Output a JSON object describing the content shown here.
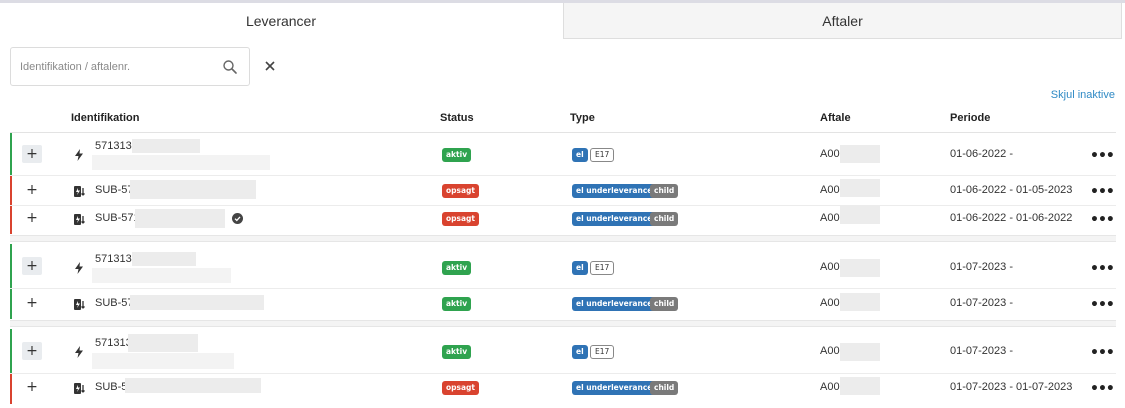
{
  "tabs": [
    {
      "label": "Leverancer",
      "active": true
    },
    {
      "label": "Aftaler",
      "active": false
    }
  ],
  "search": {
    "placeholder": "Identifikation / aftalenr.",
    "value": ""
  },
  "hide_inactive_label": "Skjul inaktive",
  "columns": {
    "identifikation": "Identifikation",
    "status": "Status",
    "type": "Type",
    "aftale": "Aftale",
    "periode": "Periode"
  },
  "rows": [
    {
      "ident": "571313",
      "status": "aktiv",
      "type": [
        "el",
        "E17"
      ],
      "aftale": "A00C",
      "periode": "01-06-2022 -"
    },
    {
      "ident": "SUB-57",
      "status": "opsagt",
      "type": [
        "el underleverance",
        "child"
      ],
      "aftale": "A00C",
      "periode": "01-06-2022 - 01-05-2023"
    },
    {
      "ident": "SUB-571",
      "status": "opsagt",
      "type": [
        "el underleverance",
        "child"
      ],
      "aftale": "A00C",
      "periode": "01-06-2022 - 01-06-2022"
    },
    {
      "ident": "571313",
      "status": "aktiv",
      "type": [
        "el",
        "E17"
      ],
      "aftale": "A00C",
      "periode": "01-07-2023 -"
    },
    {
      "ident": "SUB-57",
      "status": "aktiv",
      "type": [
        "el underleverance",
        "child"
      ],
      "aftale": "A00C",
      "periode": "01-07-2023 -"
    },
    {
      "ident": "571313",
      "status": "aktiv",
      "type": [
        "el",
        "E17"
      ],
      "aftale": "A00C",
      "periode": "01-07-2023 -"
    },
    {
      "ident": "SUB-57",
      "status": "opsagt",
      "type": [
        "el underleverance",
        "child"
      ],
      "aftale": "A00C",
      "periode": "01-07-2023 - 01-07-2023"
    }
  ],
  "colors": {
    "active_green": "#2fa34f",
    "cancelled_red": "#d9432f",
    "type_blue": "#2f73b5",
    "child_gray": "#7a7a7a",
    "link_blue": "#2f8ac5"
  }
}
